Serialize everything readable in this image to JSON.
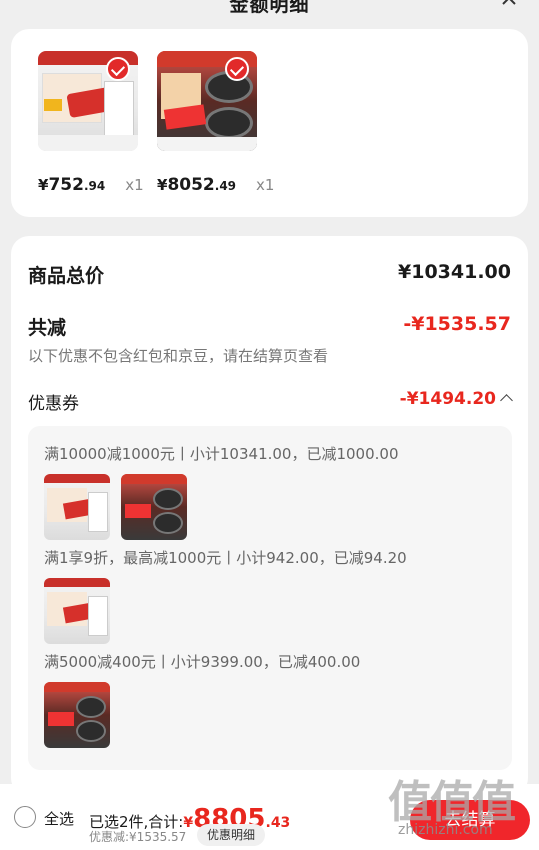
{
  "header": {
    "title": "金额明细"
  },
  "products": [
    {
      "price_yen": "¥",
      "price_int": "752",
      "price_dec": ".94",
      "qty": "x1"
    },
    {
      "price_yen": "¥",
      "price_int": "8052",
      "price_dec": ".49",
      "qty": "x1"
    }
  ],
  "summary": {
    "total_label": "商品总价",
    "total_value": "¥10341.00",
    "reduce_label": "共减",
    "reduce_value": "-¥1535.57",
    "note": "以下优惠不包含红包和京豆，请在结算页查看",
    "coupon_label": "优惠券",
    "coupon_value": "-¥1494.20"
  },
  "coupon_rules": [
    {
      "text": "满10000减1000元丨小计10341.00，已减1000.00"
    },
    {
      "text": "满1享9折，最高减1000元丨小计942.00，已减94.20"
    },
    {
      "text": "满5000减400元丨小计9399.00，已减400.00"
    }
  ],
  "bottom": {
    "select_all": "全选",
    "selected_info": "已选2件,合计:",
    "total_yen": "¥",
    "total_int": "8805",
    "total_dec": ".43",
    "discount_line": "优惠减:¥1535.57",
    "detail_button": "优惠明细",
    "checkout": "去结算"
  },
  "watermark": {
    "main": "值值值",
    "sub": "zhizhizhi.com"
  },
  "colors": {
    "accent_red": "#e8271e",
    "checkout_red": "#f0262b"
  }
}
